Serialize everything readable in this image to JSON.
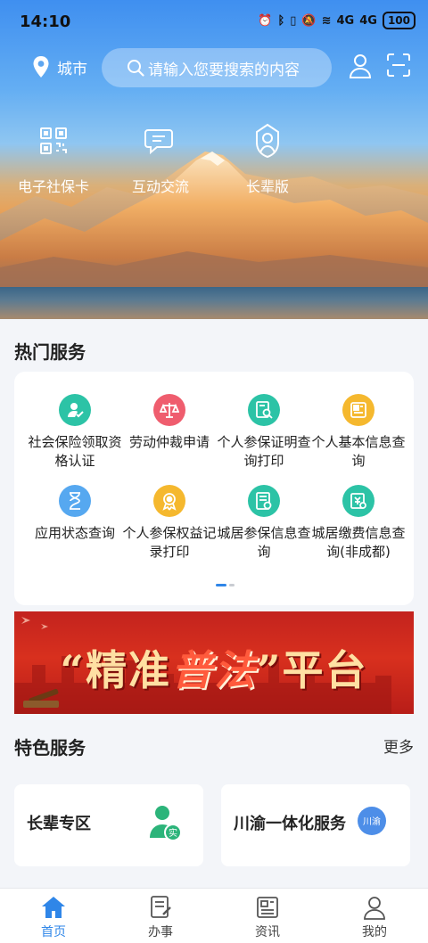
{
  "status": {
    "time": "14:10",
    "signal1": "4G",
    "signal2": "4G",
    "battery": "100"
  },
  "header": {
    "city": "城市",
    "search_placeholder": "请输入您要搜索的内容"
  },
  "quick_actions": [
    {
      "label": "电子社保卡",
      "icon": "qr-code-icon"
    },
    {
      "label": "互动交流",
      "icon": "chat-icon"
    },
    {
      "label": "长辈版",
      "icon": "elder-icon"
    }
  ],
  "hot": {
    "title": "热门服务",
    "items": [
      {
        "label": "社会保险领取资格认证",
        "icon": "user-check-icon",
        "color": "#2cc3a6"
      },
      {
        "label": "劳动仲裁申请",
        "icon": "scales-icon",
        "color": "#ef5d6e"
      },
      {
        "label": "个人参保证明查询打印",
        "icon": "document-search-icon",
        "color": "#2cc3a6"
      },
      {
        "label": "个人基本信息查询",
        "icon": "id-card-icon",
        "color": "#f5b82e"
      },
      {
        "label": "应用状态查询",
        "icon": "hourglass-icon",
        "color": "#56a8f0"
      },
      {
        "label": "个人参保权益记录打印",
        "icon": "badge-icon",
        "color": "#f5b82e"
      },
      {
        "label": "城居参保信息查询",
        "icon": "file-clock-icon",
        "color": "#2cc3a6"
      },
      {
        "label": "城居缴费信息查询(非成都)",
        "icon": "payment-search-icon",
        "color": "#2cc3a6"
      }
    ]
  },
  "banner": {
    "quote_open": "“",
    "left": "精准",
    "mid": "普法",
    "quote_close": "”",
    "right": "平台"
  },
  "featured": {
    "title": "特色服务",
    "more": "更多",
    "items": [
      {
        "label": "长辈专区",
        "badge": "实"
      },
      {
        "label": "川渝一体化服务",
        "badge": "川渝"
      }
    ]
  },
  "tabs": [
    {
      "label": "首页",
      "icon": "home-icon",
      "active": true
    },
    {
      "label": "办事",
      "icon": "task-icon",
      "active": false
    },
    {
      "label": "资讯",
      "icon": "news-icon",
      "active": false
    },
    {
      "label": "我的",
      "icon": "profile-icon",
      "active": false
    }
  ],
  "colors": {
    "accent": "#2f86e8",
    "banner": "#c3231e"
  }
}
